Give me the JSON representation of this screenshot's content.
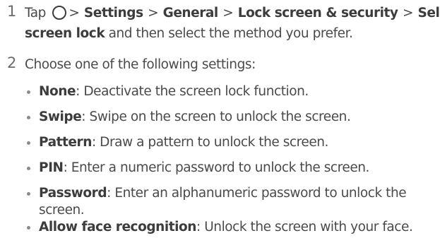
{
  "step1": {
    "number": "1",
    "tap": "Tap",
    "arrow": ">",
    "settings": "Settings",
    "general": "General",
    "lock_screen_security": "Lock screen & security",
    "select": "Select",
    "screen_lock": "screen lock",
    "rest": "and then select the method you prefer."
  },
  "step2": {
    "number": "2",
    "text": "Choose one of the following settings:"
  },
  "options": [
    {
      "term": "None",
      "desc": "Deactivate the screen lock function."
    },
    {
      "term": "Swipe",
      "desc": "Swipe on the screen to unlock the screen."
    },
    {
      "term": "Pattern",
      "desc": "Draw a pattern to unlock the screen."
    },
    {
      "term": "PIN",
      "desc": "Enter a numeric password to unlock the screen."
    },
    {
      "term": "Password",
      "desc": "Enter an alphanumeric password to unlock the",
      "desc_cont": "screen."
    },
    {
      "term": "Allow face recognition",
      "desc": "Unlock the screen with your face."
    }
  ]
}
